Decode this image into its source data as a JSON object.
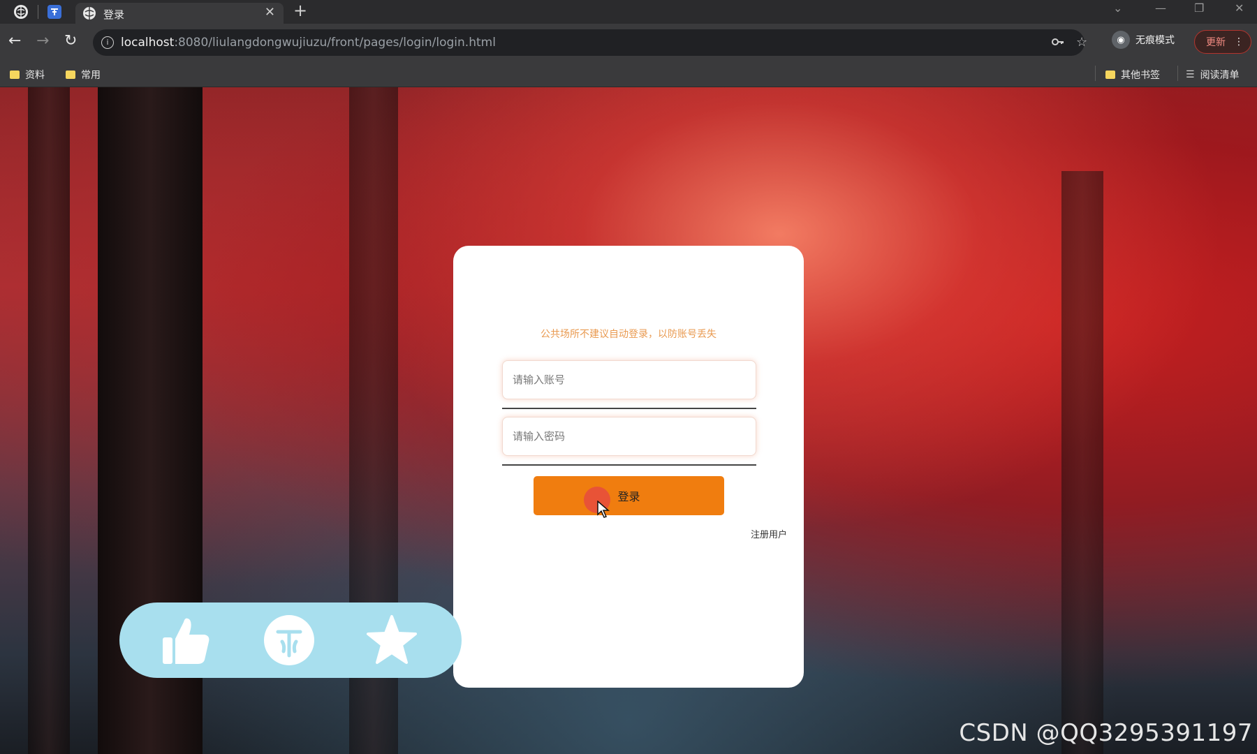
{
  "browser": {
    "tab_title": "登录",
    "url_host": "localhost",
    "url_rest": ":8080/liulangdongwujiuzu/front/pages/login/login.html",
    "profile_label": "无痕模式",
    "update_label": "更新",
    "bookmarks": [
      "资料",
      "常用"
    ],
    "other_bookmarks": "其他书签",
    "reading_list": "阅读清单"
  },
  "login": {
    "tip": "公共场所不建议自动登录，以防账号丢失",
    "account_placeholder": "请输入账号",
    "password_placeholder": "请输入密码",
    "login_button": "登录",
    "register_link": "注册用户"
  },
  "overlay": {
    "actions": [
      "thumbs-up-icon",
      "coin-icon",
      "star-icon"
    ],
    "watermark": "CSDN @QQ3295391197"
  },
  "colors": {
    "accent_orange": "#f07d0f",
    "tip_orange": "#e99a50",
    "action_bar": "#a8dfee"
  }
}
